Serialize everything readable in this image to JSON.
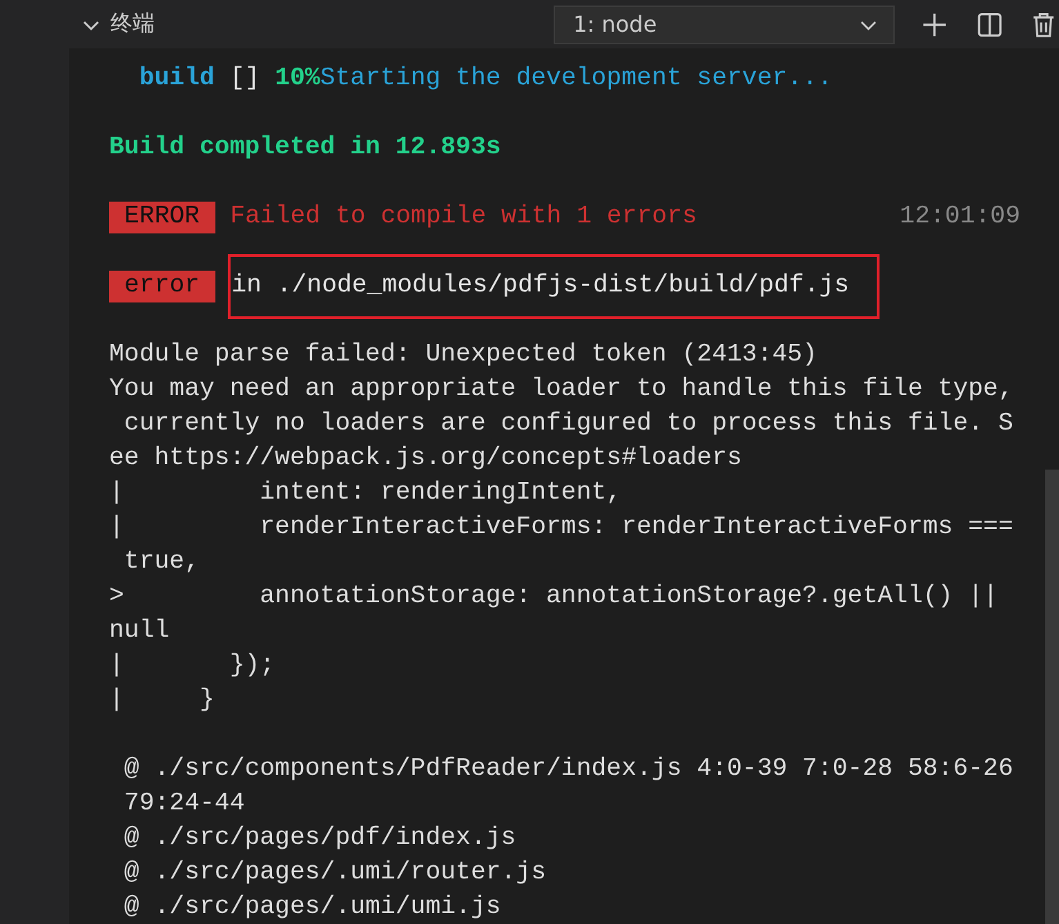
{
  "panel": {
    "title": "终端",
    "expanded": true,
    "dropdown": {
      "value": "1: node"
    }
  },
  "blocks": [
    {
      "lines": [
        {
          "kind": "segments",
          "segments": [
            {
              "kind": "label",
              "text": "  build"
            },
            {
              "kind": "plain",
              "text": " [] "
            },
            {
              "kind": "percent",
              "text": "10%"
            },
            {
              "kind": "message",
              "text": "Starting the development server..."
            }
          ]
        }
      ]
    },
    {
      "lines": [
        {
          "kind": "success",
          "text": "Build completed in 12.893s"
        }
      ]
    },
    {
      "lines": [
        {
          "kind": "badge",
          "badge": "ERROR",
          "text": "Failed to compile with 1 errors",
          "time": "12:01:09",
          "highlighted": false
        }
      ]
    },
    {
      "lines": [
        {
          "kind": "badge",
          "badge": "error",
          "text": "in ./node_modules/pdfjs-dist/build/pdf.js",
          "highlighted": true
        }
      ]
    },
    {
      "lines": [
        {
          "kind": "text",
          "text": "Module parse failed: Unexpected token (2413:45)"
        },
        {
          "kind": "text",
          "text": "You may need an appropriate loader to handle this file type,"
        },
        {
          "kind": "text",
          "text": " currently no loaders are configured to process this file. S"
        },
        {
          "kind": "text",
          "text": "ee https://webpack.js.org/concepts#loaders"
        },
        {
          "kind": "text",
          "text": "|         intent: renderingIntent,"
        },
        {
          "kind": "text",
          "text": "|         renderInteractiveForms: renderInteractiveForms ==="
        },
        {
          "kind": "text",
          "text": " true,"
        },
        {
          "kind": "text",
          "text": ">         annotationStorage: annotationStorage?.getAll() ||"
        },
        {
          "kind": "text",
          "text": "null"
        },
        {
          "kind": "text",
          "text": "|       });"
        },
        {
          "kind": "text",
          "text": "|     }"
        }
      ]
    },
    {
      "lines": [
        {
          "kind": "text",
          "text": " @ ./src/components/PdfReader/index.js 4:0-39 7:0-28 58:6-26"
        },
        {
          "kind": "text",
          "text": " 79:24-44"
        },
        {
          "kind": "text",
          "text": " @ ./src/pages/pdf/index.js"
        },
        {
          "kind": "text",
          "text": " @ ./src/pages/.umi/router.js"
        },
        {
          "kind": "text",
          "text": " @ ./src/pages/.umi/umi.js"
        }
      ]
    }
  ]
}
